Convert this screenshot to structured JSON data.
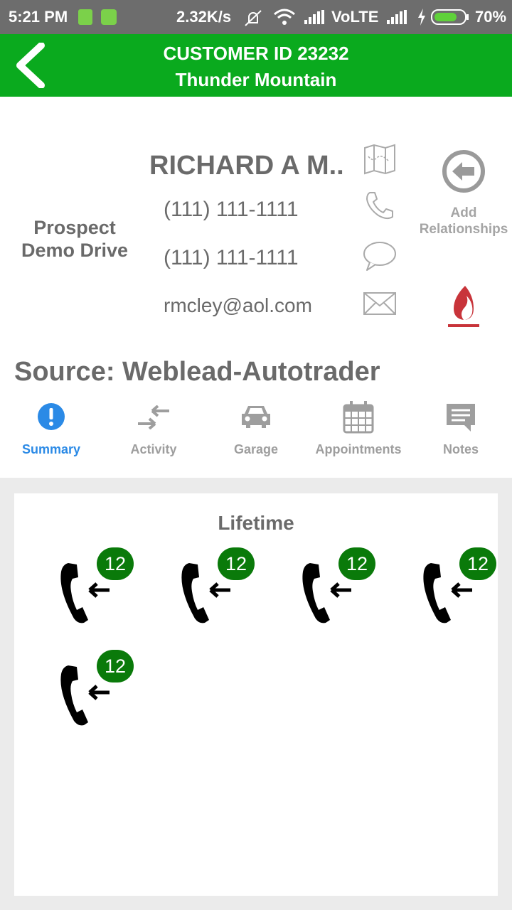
{
  "status_bar": {
    "time": "5:21 PM",
    "net_speed": "2.32K/s",
    "network": "VoLTE",
    "battery": "70%"
  },
  "header": {
    "title": "CUSTOMER ID 23232",
    "subtitle": "Thunder Mountain"
  },
  "customer": {
    "name": "RICHARD A M..",
    "phone1": "(111) 111-1111",
    "phone2": "(111) 111-1111",
    "email": "rmcley@aol.com",
    "status": "Prospect",
    "status_detail": "Demo Drive",
    "add_relationships": "Add\nRelationships",
    "source": "Source: Weblead-Autotrader"
  },
  "tabs": [
    {
      "label": "Summary"
    },
    {
      "label": "Activity"
    },
    {
      "label": "Garage"
    },
    {
      "label": "Appointments"
    },
    {
      "label": "Notes"
    }
  ],
  "summary": {
    "heading": "Lifetime",
    "calls": [
      {
        "count": "12"
      },
      {
        "count": "12"
      },
      {
        "count": "12"
      },
      {
        "count": "12"
      },
      {
        "count": "12"
      }
    ]
  },
  "colors": {
    "header_green": "#0aaa1e",
    "badge_green": "#0a7a0a",
    "active_tab_blue": "#2b8ae6",
    "flame_red": "#c8343a"
  }
}
